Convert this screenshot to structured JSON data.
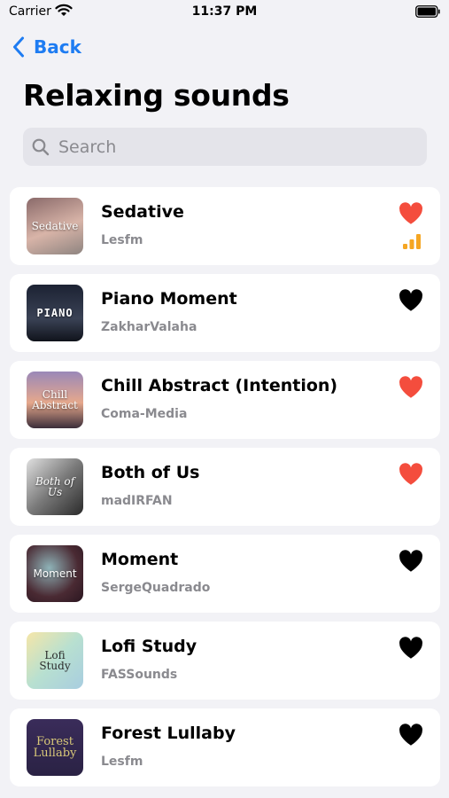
{
  "status_bar": {
    "carrier": "Carrier",
    "time": "11:37 PM"
  },
  "nav": {
    "back_label": "Back"
  },
  "title": "Relaxing sounds",
  "search": {
    "placeholder": "Search",
    "value": ""
  },
  "colors": {
    "accent": "#1e7cf2",
    "liked": "#f44d3d",
    "unliked": "#000000",
    "playing": "#f5a623"
  },
  "tracks": [
    {
      "name": "Sedative",
      "artist": "Lesfm",
      "art_text": "Sedative",
      "liked": true,
      "playing": true
    },
    {
      "name": "Piano Moment",
      "artist": "ZakharValaha",
      "art_text": "PIANO",
      "liked": false,
      "playing": false
    },
    {
      "name": "Chill Abstract (Intention)",
      "artist": "Coma-Media",
      "art_text": "Chill Abstract",
      "liked": true,
      "playing": false
    },
    {
      "name": "Both of Us",
      "artist": "madIRFAN",
      "art_text": "Both of Us",
      "liked": true,
      "playing": false
    },
    {
      "name": "Moment",
      "artist": "SergeQuadrado",
      "art_text": "Moment",
      "liked": false,
      "playing": false
    },
    {
      "name": "Lofi Study",
      "artist": "FASSounds",
      "art_text": "Lofi Study",
      "liked": false,
      "playing": false
    },
    {
      "name": "Forest Lullaby",
      "artist": "Lesfm",
      "art_text": "Forest Lullaby",
      "liked": false,
      "playing": false
    }
  ]
}
